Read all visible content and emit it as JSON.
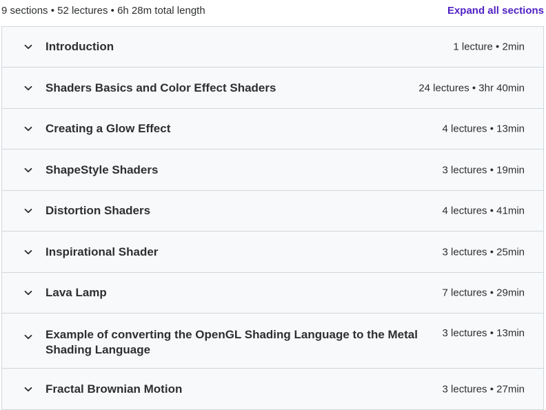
{
  "summary": "9 sections • 52 lectures • 6h 28m total length",
  "expand_all_label": "Expand all sections",
  "sections": [
    {
      "title": "Introduction",
      "meta": "1 lecture • 2min"
    },
    {
      "title": "Shaders Basics and Color Effect Shaders",
      "meta": "24 lectures • 3hr 40min"
    },
    {
      "title": "Creating a Glow Effect",
      "meta": "4 lectures • 13min"
    },
    {
      "title": "ShapeStyle Shaders",
      "meta": "3 lectures • 19min"
    },
    {
      "title": "Distortion Shaders",
      "meta": "4 lectures • 41min"
    },
    {
      "title": "Inspirational Shader",
      "meta": "3 lectures • 25min"
    },
    {
      "title": "Lava Lamp",
      "meta": "7 lectures • 29min"
    },
    {
      "title": "Example of converting the OpenGL Shading Language to the Metal Shading Language",
      "meta": "3 lectures • 13min"
    },
    {
      "title": "Fractal Brownian Motion",
      "meta": "3 lectures • 27min"
    }
  ],
  "colors": {
    "accent": "#5022c3",
    "row_background": "#f7f9fa",
    "border": "#d1d7dc",
    "text": "#2d2f31"
  },
  "icons": {
    "section_toggle": "chevron-down-icon"
  }
}
